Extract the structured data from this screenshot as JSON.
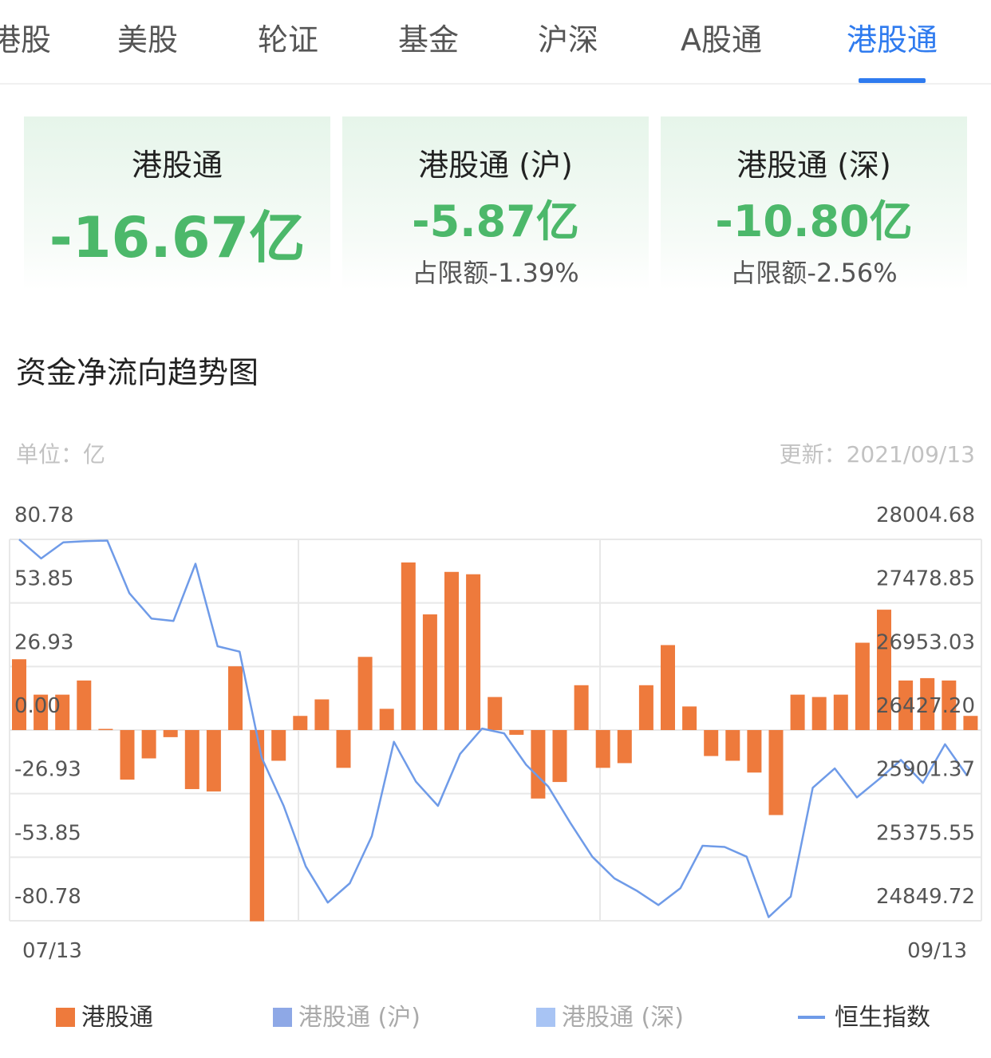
{
  "tabs": [
    "港股",
    "美股",
    "轮证",
    "基金",
    "沪深",
    "A股通",
    "港股通"
  ],
  "active_tab": "港股通",
  "colors": {
    "accent": "#2f7bef",
    "green": "#4cb86a",
    "bar": "#ee7a3c",
    "line": "#6f9be8",
    "sh": "#8ea8e6",
    "sz": "#a8c4f4"
  },
  "cards": [
    {
      "title": "港股通",
      "value": "-16.67亿",
      "sub": ""
    },
    {
      "title": "港股通 (沪)",
      "value": "-5.87亿",
      "sub": "占限额-1.39%"
    },
    {
      "title": "港股通 (深)",
      "value": "-10.80亿",
      "sub": "占限额-2.56%"
    }
  ],
  "section_title": "资金净流向趋势图",
  "unit_label": "单位：亿",
  "updated_label": "更新：2021/09/13",
  "legend": [
    {
      "label": "港股通",
      "kind": "bar"
    },
    {
      "label": "港股通 (沪)",
      "kind": "bar-muted"
    },
    {
      "label": "港股通 (深)",
      "kind": "bar-muted"
    },
    {
      "label": "恒生指数",
      "kind": "line"
    }
  ],
  "chart_data": {
    "type": "bar+line",
    "x_start": "07/13",
    "x_end": "09/13",
    "left_axis": {
      "ticks": [
        "80.78",
        "53.85",
        "26.93",
        "0.00",
        "-26.93",
        "-53.85",
        "-80.78"
      ],
      "ylim": [
        -80.78,
        80.78
      ]
    },
    "right_axis": {
      "ticks": [
        "28004.68",
        "27478.85",
        "26953.03",
        "26427.20",
        "25901.37",
        "25375.55",
        "24849.72"
      ],
      "ylim": [
        24849.72,
        28004.68
      ]
    },
    "grid": true,
    "series": [
      {
        "name": "港股通",
        "kind": "bar",
        "values": [
          30,
          15,
          15,
          21,
          0.5,
          -21,
          -12,
          -3,
          -25,
          -26,
          27,
          -81,
          -13,
          6,
          13,
          -16,
          31,
          9,
          71,
          49,
          67,
          66,
          14,
          -2,
          -29,
          -22,
          19,
          -16,
          -14,
          19,
          36,
          10,
          -11,
          -13,
          -18,
          -36,
          15,
          14,
          15,
          37,
          51,
          21,
          22,
          21,
          6
        ]
      },
      {
        "name": "恒生指数",
        "kind": "line",
        "values": [
          28004,
          27847,
          27980,
          27990,
          27995,
          27560,
          27350,
          27330,
          27803,
          27120,
          27076,
          26200,
          25800,
          25300,
          25000,
          25160,
          25550,
          26330,
          26000,
          25800,
          26230,
          26440,
          26400,
          26140,
          25960,
          25660,
          25380,
          25200,
          25100,
          24980,
          25120,
          25470,
          25460,
          25380,
          24880,
          25050,
          25950,
          26110,
          25870,
          26020,
          26180,
          25990,
          26310,
          26050
        ]
      }
    ]
  }
}
